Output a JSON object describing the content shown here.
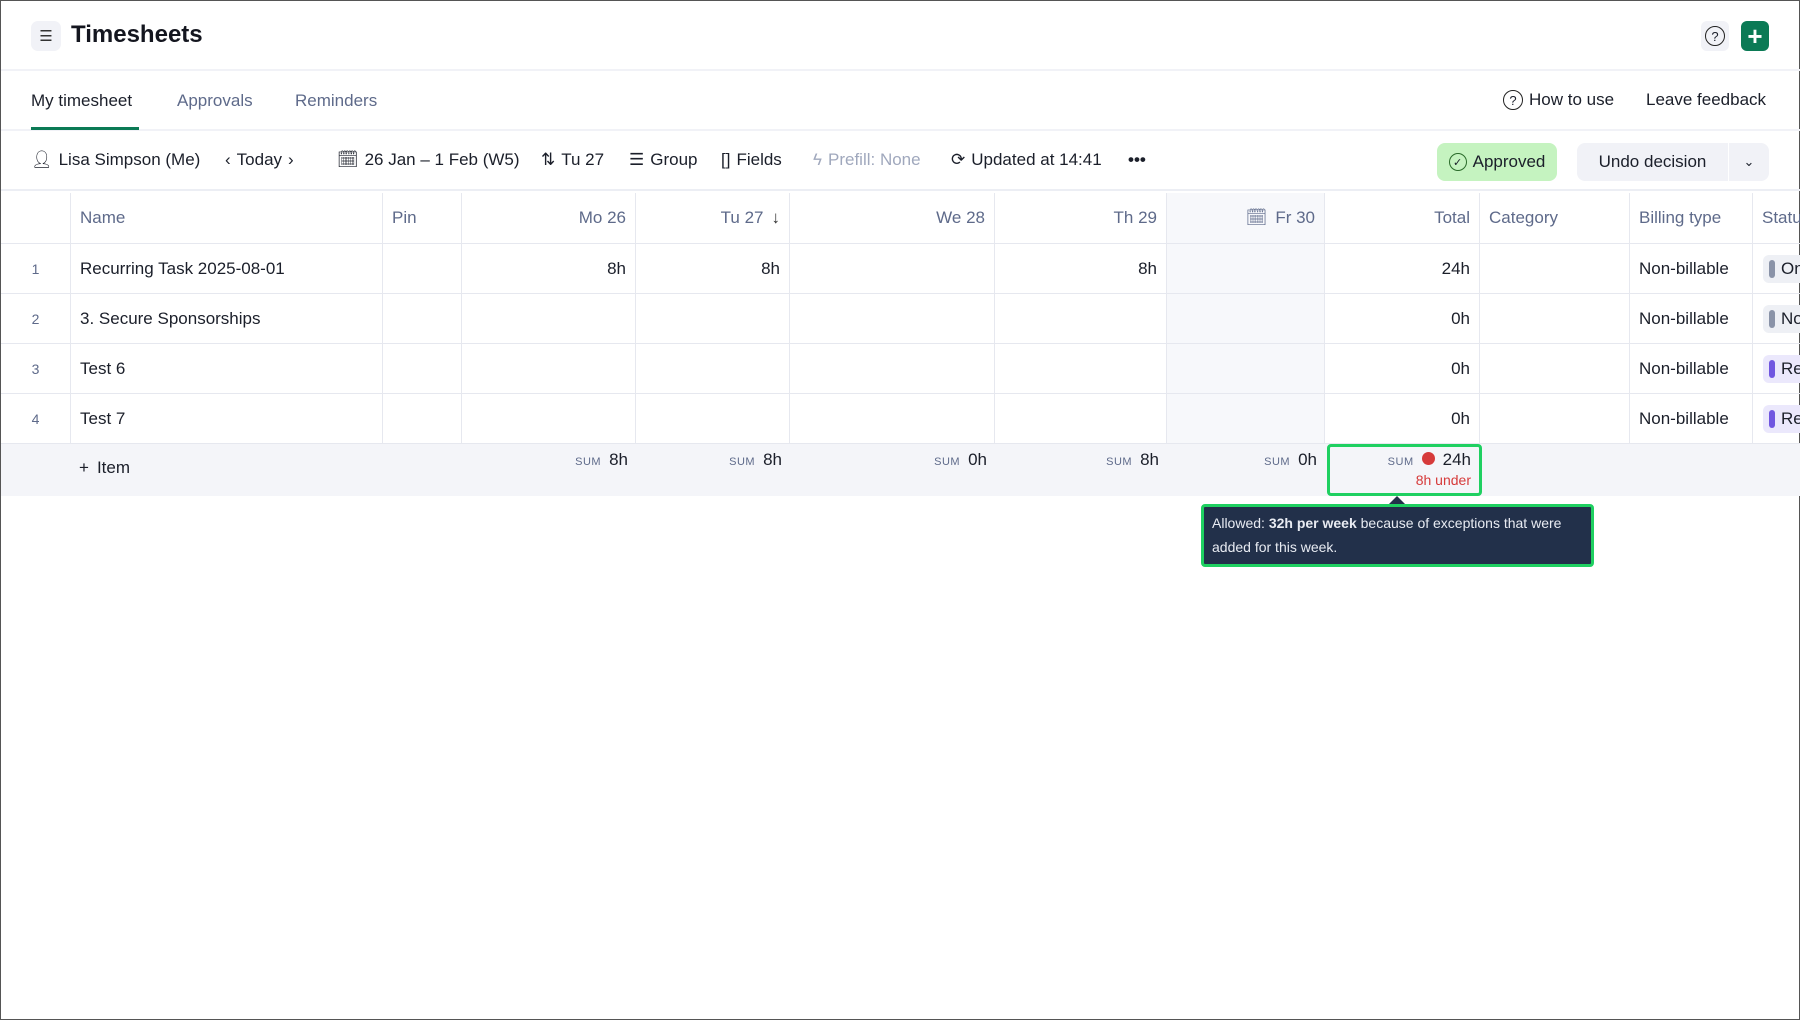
{
  "header": {
    "title": "Timesheets",
    "menu_icon": "hamburger-icon",
    "help_icon": "question-circle-icon",
    "add_icon": "plus-icon"
  },
  "tabs": [
    {
      "label": "My timesheet",
      "active": true
    },
    {
      "label": "Approvals"
    },
    {
      "label": "Reminders"
    }
  ],
  "tab_actions": {
    "how_to_use": "How to use",
    "leave_feedback": "Leave feedback"
  },
  "toolbar": {
    "user": "Lisa Simpson (Me)",
    "today": "Today",
    "date_range": "26 Jan – 1 Feb (W5)",
    "sort": "Tu 27",
    "group": "Group",
    "fields": "Fields",
    "prefill": "Prefill: None",
    "updated": "Updated at 14:41",
    "more": "•••",
    "status": "Approved",
    "undo": "Undo decision"
  },
  "table": {
    "columns": [
      "Name",
      "Pin",
      "Mo 26",
      "Tu 27",
      "We 28",
      "Th 29",
      "Fr 30",
      "Total",
      "Category",
      "Billing type",
      "Status"
    ],
    "rows": [
      {
        "n": "1",
        "name": "Recurring Task 2025-08-01",
        "mo": "8h",
        "tu": "8h",
        "we": "",
        "th": "8h",
        "fr": "",
        "total": "24h",
        "category": "",
        "billing": "Non-billable",
        "status": "On",
        "status_color": "#8a93a8"
      },
      {
        "n": "2",
        "name": "3. Secure Sponsorships",
        "mo": "",
        "tu": "",
        "we": "",
        "th": "",
        "fr": "",
        "total": "0h",
        "category": "",
        "billing": "Non-billable",
        "status": "No",
        "status_color": "#8a93a8"
      },
      {
        "n": "3",
        "name": "Test 6",
        "mo": "",
        "tu": "",
        "we": "",
        "th": "",
        "fr": "",
        "total": "0h",
        "category": "",
        "billing": "Non-billable",
        "status": "Re",
        "status_color": "#7056e0"
      },
      {
        "n": "4",
        "name": "Test 7",
        "mo": "",
        "tu": "",
        "we": "",
        "th": "",
        "fr": "",
        "total": "0h",
        "category": "",
        "billing": "Non-billable",
        "status": "Re",
        "status_color": "#7056e0"
      }
    ],
    "footer": {
      "add_item": "Item",
      "sum_label": "SUM",
      "sums": {
        "mo": "8h",
        "tu": "8h",
        "we": "0h",
        "th": "8h",
        "fr": "0h",
        "total": "24h"
      },
      "under": "8h under"
    }
  },
  "tooltip": {
    "prefix": "Allowed: ",
    "bold": "32h per week",
    "suffix": " because of exceptions that were added for this week."
  },
  "colors": {
    "accent": "#0b7a55",
    "approved_bg": "#c5f3c0",
    "under": "#d63a3a"
  }
}
